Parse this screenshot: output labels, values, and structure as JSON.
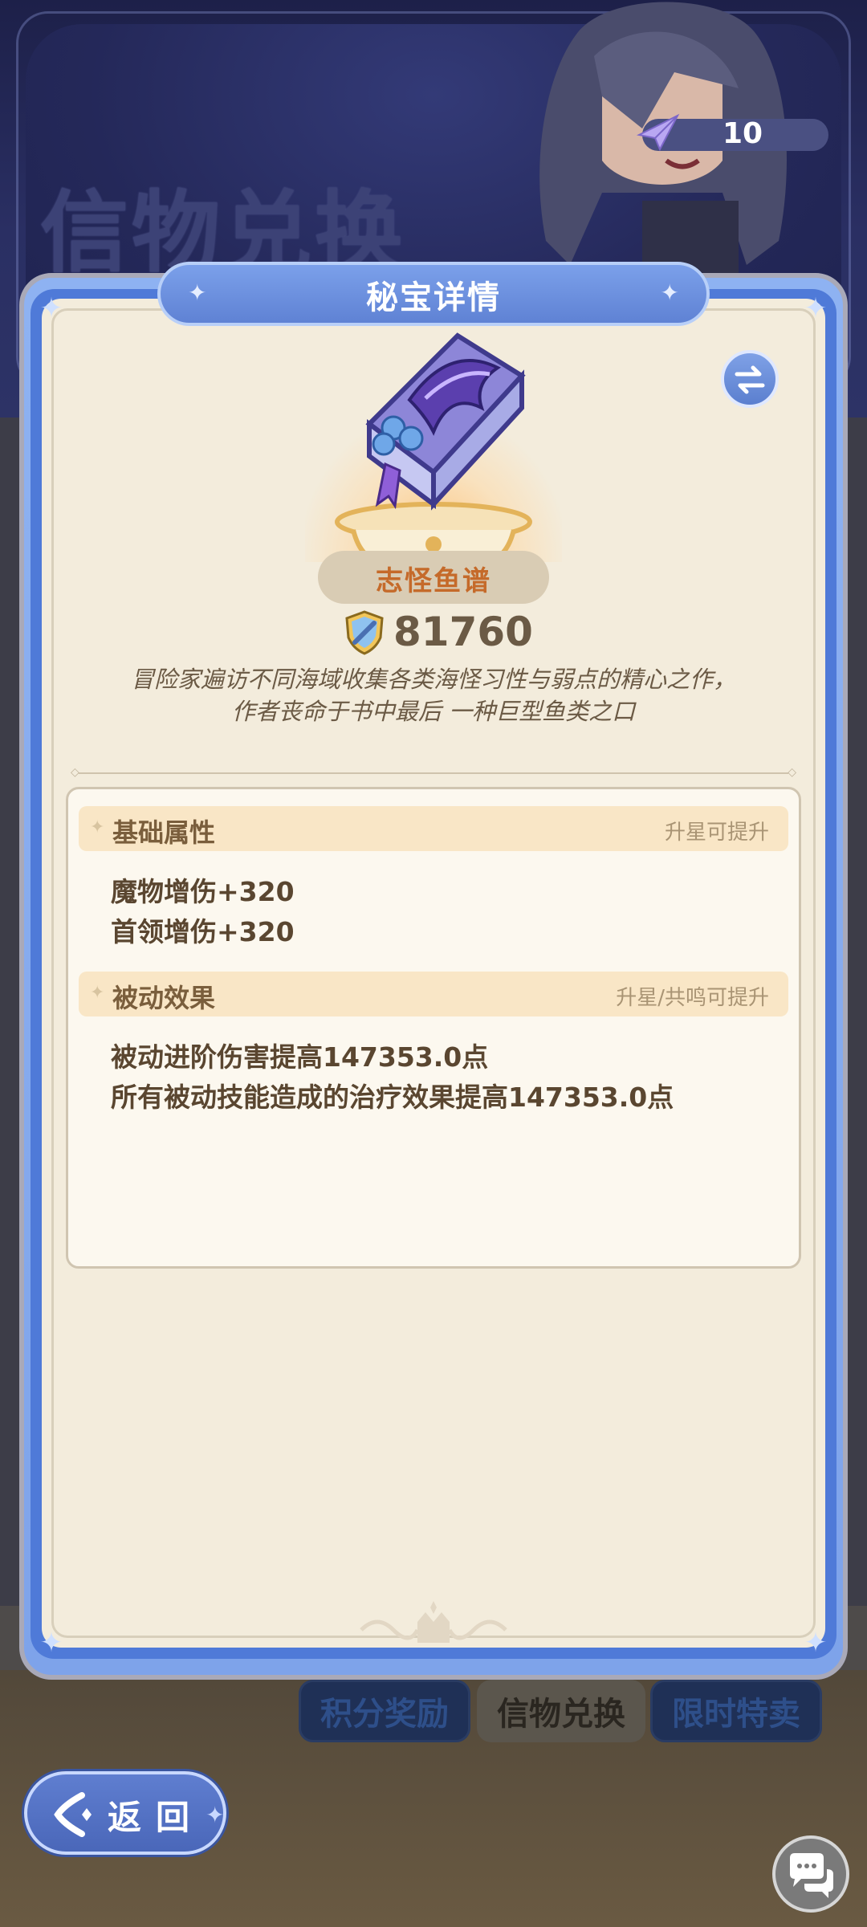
{
  "background": {
    "page_title": "信物兑换",
    "currency_value": "10",
    "tabs": [
      "积分奖励",
      "信物兑换",
      "限时特卖"
    ]
  },
  "modal": {
    "title": "秘宝详情",
    "item": {
      "name": "志怪鱼谱",
      "power": "81760",
      "description_line1": "冒险家遍访不同海域收集各类海怪习性与弱点的精心之作，",
      "description_line2": "作者丧命于书中最后 一种巨型鱼类之口"
    },
    "sections": {
      "base": {
        "title": "基础属性",
        "note": "升星可提升",
        "lines": [
          "魔物增伤+320",
          "首领增伤+320"
        ]
      },
      "passive": {
        "title": "被动效果",
        "note": "升星/共鸣可提升",
        "lines": [
          "被动进阶伤害提高147353.0点",
          "所有被动技能造成的治疗效果提高147353.0点"
        ]
      }
    }
  },
  "back_button": {
    "label": "返回"
  },
  "colors": {
    "accent_blue": "#5f82d4",
    "panel_cream": "#f3ecdc",
    "item_name_orange": "#c56a2a"
  }
}
